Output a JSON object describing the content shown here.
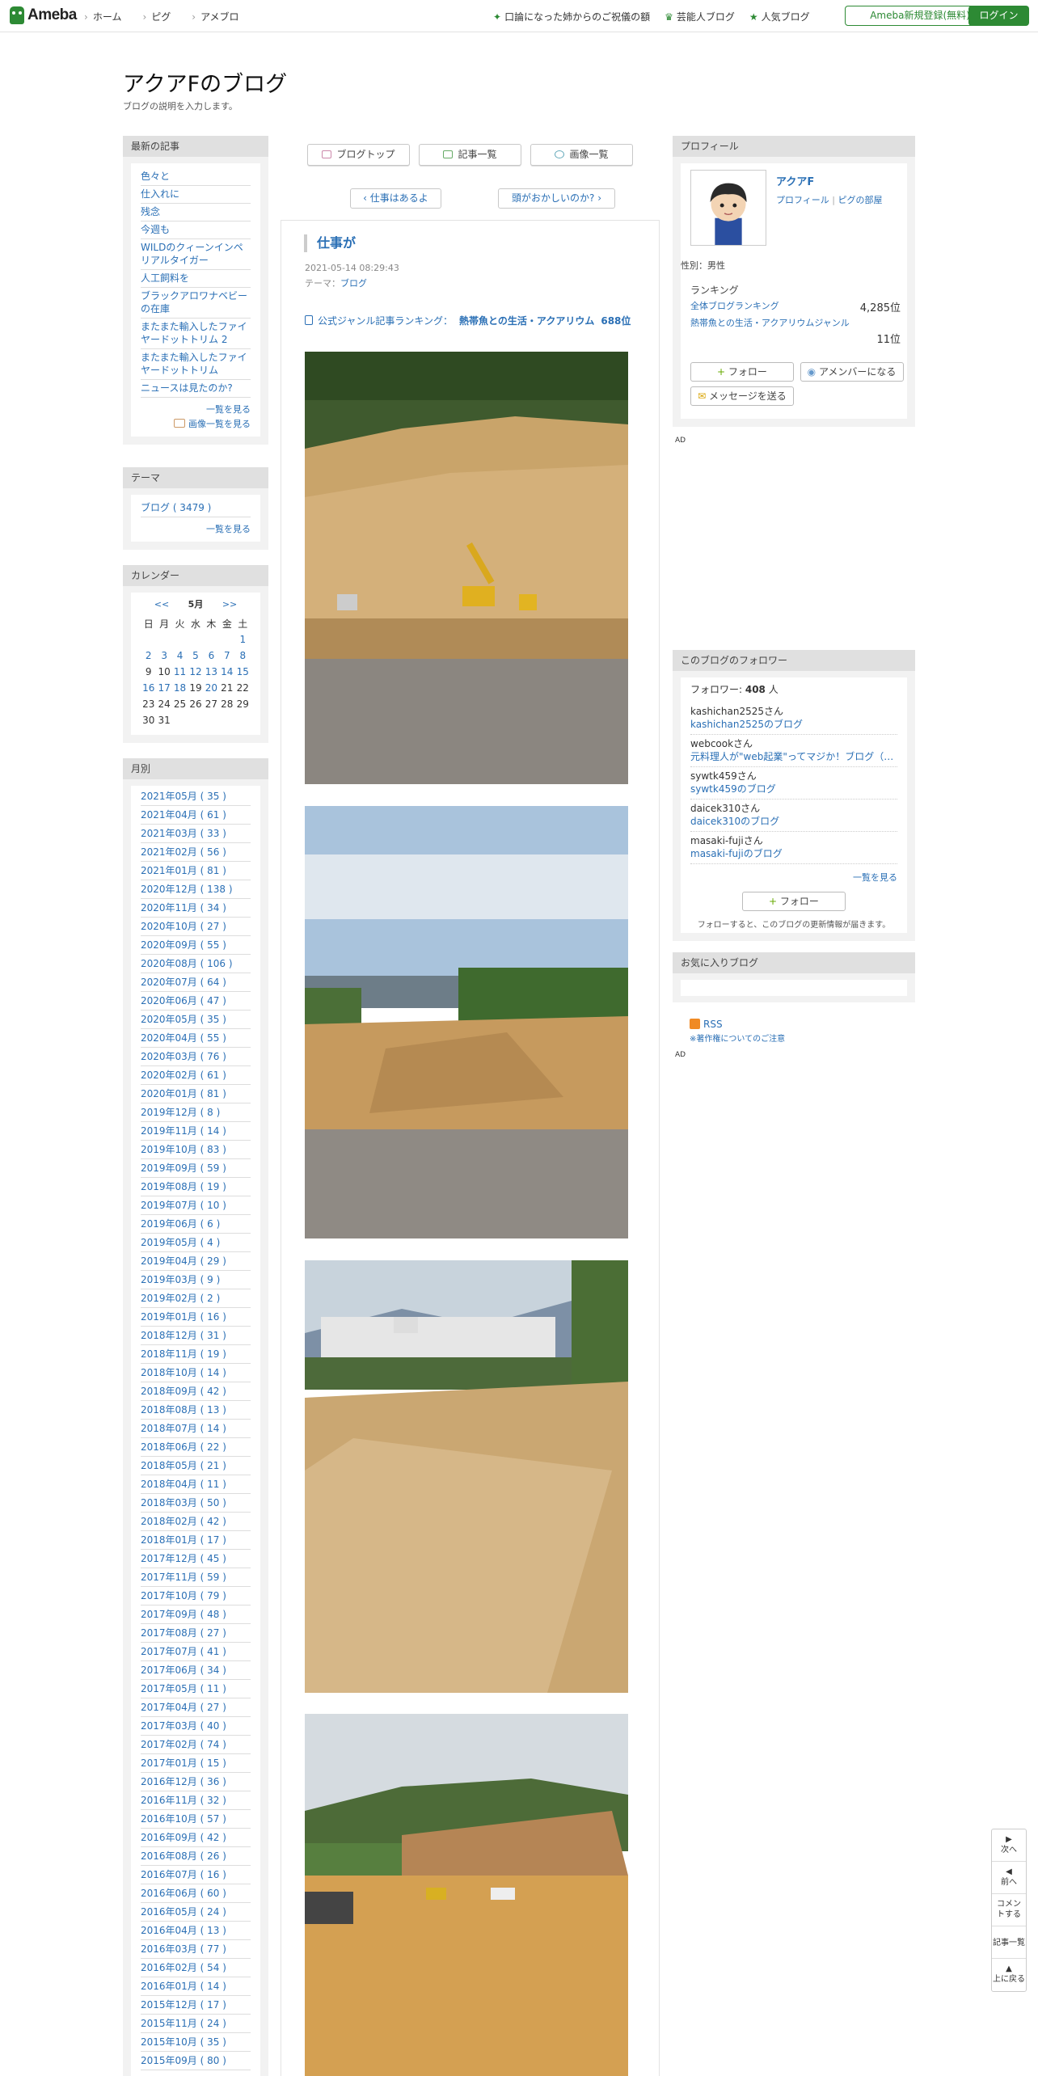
{
  "header": {
    "logo": "Ameba",
    "nav": [
      "ホーム",
      "ピグ",
      "アメブロ"
    ],
    "right_nav": [
      "口論になった姉からのご祝儀の額",
      "芸能人ブログ",
      "人気ブログ"
    ],
    "signup": "Ameba新規登録(無料)",
    "login": "ログイン"
  },
  "blog": {
    "title": "アクアFのブログ",
    "description": "ブログの説明を入力します。"
  },
  "recent": {
    "heading": "最新の記事",
    "items": [
      "色々と",
      "仕入れに",
      "残念",
      "今週も",
      "WILDのクィーンインペリアルタイガー",
      "人工飼料を",
      "ブラックアロワナベビーの在庫",
      "またまた輸入したファイヤードットトリム 2",
      "またまた輸入したファイヤードットトリム",
      "ニュースは見たのか?"
    ],
    "more": "一覧を見る",
    "images_more": "画像一覧を見る"
  },
  "theme": {
    "heading": "テーマ",
    "items": [
      "ブログ ( 3479 )"
    ],
    "more": "一覧を見る"
  },
  "calendar": {
    "heading": "カレンダー",
    "prev": "<<",
    "next": ">>",
    "month": "5月",
    "weekdays": [
      "日",
      "月",
      "火",
      "水",
      "木",
      "金",
      "土"
    ],
    "rows": [
      [
        "",
        "",
        "",
        "",
        "",
        "",
        "1"
      ],
      [
        "2",
        "3",
        "4",
        "5",
        "6",
        "7",
        "8"
      ],
      [
        "9",
        "10",
        "11",
        "12",
        "13",
        "14",
        "15"
      ],
      [
        "16",
        "17",
        "18",
        "19",
        "20",
        "21",
        "22"
      ],
      [
        "23",
        "24",
        "25",
        "26",
        "27",
        "28",
        "29"
      ],
      [
        "30",
        "31",
        "",
        "",
        "",
        "",
        ""
      ]
    ],
    "linked": [
      "1",
      "2",
      "3",
      "4",
      "5",
      "6",
      "7",
      "8",
      "11",
      "12",
      "13",
      "14",
      "15",
      "16",
      "17",
      "18",
      "20"
    ]
  },
  "archive": {
    "heading": "月別",
    "items": [
      "2021年05月 ( 35 )",
      "2021年04月 ( 61 )",
      "2021年03月 ( 33 )",
      "2021年02月 ( 56 )",
      "2021年01月 ( 81 )",
      "2020年12月 ( 138 )",
      "2020年11月 ( 34 )",
      "2020年10月 ( 27 )",
      "2020年09月 ( 55 )",
      "2020年08月 ( 106 )",
      "2020年07月 ( 64 )",
      "2020年06月 ( 47 )",
      "2020年05月 ( 35 )",
      "2020年04月 ( 55 )",
      "2020年03月 ( 76 )",
      "2020年02月 ( 61 )",
      "2020年01月 ( 81 )",
      "2019年12月 ( 8 )",
      "2019年11月 ( 14 )",
      "2019年10月 ( 83 )",
      "2019年09月 ( 59 )",
      "2019年08月 ( 19 )",
      "2019年07月 ( 10 )",
      "2019年06月 ( 6 )",
      "2019年05月 ( 4 )",
      "2019年04月 ( 29 )",
      "2019年03月 ( 9 )",
      "2019年02月 ( 2 )",
      "2019年01月 ( 16 )",
      "2018年12月 ( 31 )",
      "2018年11月 ( 19 )",
      "2018年10月 ( 14 )",
      "2018年09月 ( 42 )",
      "2018年08月 ( 13 )",
      "2018年07月 ( 14 )",
      "2018年06月 ( 22 )",
      "2018年05月 ( 21 )",
      "2018年04月 ( 11 )",
      "2018年03月 ( 50 )",
      "2018年02月 ( 42 )",
      "2018年01月 ( 17 )",
      "2017年12月 ( 45 )",
      "2017年11月 ( 59 )",
      "2017年10月 ( 79 )",
      "2017年09月 ( 48 )",
      "2017年08月 ( 27 )",
      "2017年07月 ( 41 )",
      "2017年06月 ( 34 )",
      "2017年05月 ( 11 )",
      "2017年04月 ( 27 )",
      "2017年03月 ( 40 )",
      "2017年02月 ( 74 )",
      "2017年01月 ( 15 )",
      "2016年12月 ( 36 )",
      "2016年11月 ( 32 )",
      "2016年10月 ( 57 )",
      "2016年09月 ( 42 )",
      "2016年08月 ( 26 )",
      "2016年07月 ( 16 )",
      "2016年06月 ( 60 )",
      "2016年05月 ( 24 )",
      "2016年04月 ( 13 )",
      "2016年03月 ( 77 )",
      "2016年02月 ( 54 )",
      "2016年01月 ( 14 )",
      "2015年12月 ( 17 )",
      "2015年11月 ( 24 )",
      "2015年10月 ( 35 )",
      "2015年09月 ( 80 )"
    ]
  },
  "tabs": [
    "ブログトップ",
    "記事一覧",
    "画像一覧"
  ],
  "pager": {
    "prev": "仕事はあるよ",
    "next": "頭がおかしいのか?"
  },
  "entry": {
    "title": "仕事が",
    "date": "2021-05-14 08:29:43",
    "theme_label": "テーマ：",
    "theme": "ブログ",
    "ranking_label": "公式ジャンル記事ランキング：",
    "ranking_genre": "熱帯魚との生活・アクアリウム",
    "ranking_rank": "688位"
  },
  "profile": {
    "heading": "プロフィール",
    "name": "アクアF",
    "links": [
      "プロフィール",
      "ピグの部屋"
    ],
    "gender": "性別：男性",
    "ranking_heading": "ランキング",
    "overall_label": "全体ブログランキング",
    "overall_rank": "4,285位",
    "genre_label": "熱帯魚との生活・アクアリウムジャンル",
    "genre_rank": "11位",
    "follow": "フォロー",
    "member": "アメンバーになる",
    "message": "メッセージを送る"
  },
  "ad_label": "AD",
  "followers": {
    "heading": "このブログのフォロワー",
    "count_label": "フォロワー: ",
    "count": "408",
    "count_unit": " 人",
    "items": [
      {
        "name": "kashichan2525さん",
        "blog": "kashichan2525のブログ"
      },
      {
        "name": "webcookさん",
        "blog": "元料理人が\"web起業\"ってマジか！ブログ（兵…"
      },
      {
        "name": "sywtk459さん",
        "blog": "sywtk459のブログ"
      },
      {
        "name": "daicek310さん",
        "blog": "daicek310のブログ"
      },
      {
        "name": "masaki-fujiさん",
        "blog": "masaki-fujiのブログ"
      }
    ],
    "more": "一覧を見る",
    "follow": "フォロー",
    "note": "フォローすると、このブログの更新情報が届きます。"
  },
  "favorites": {
    "heading": "お気に入りブログ"
  },
  "rss": {
    "label": "RSS",
    "copyright": "※著作権についてのご注意"
  },
  "widget": [
    "次へ",
    "前へ",
    "コメントする",
    "記事一覧",
    "上に戻る"
  ],
  "colors": {
    "brand_green": "#2d8a34",
    "link_blue": "#2a6fb5"
  }
}
